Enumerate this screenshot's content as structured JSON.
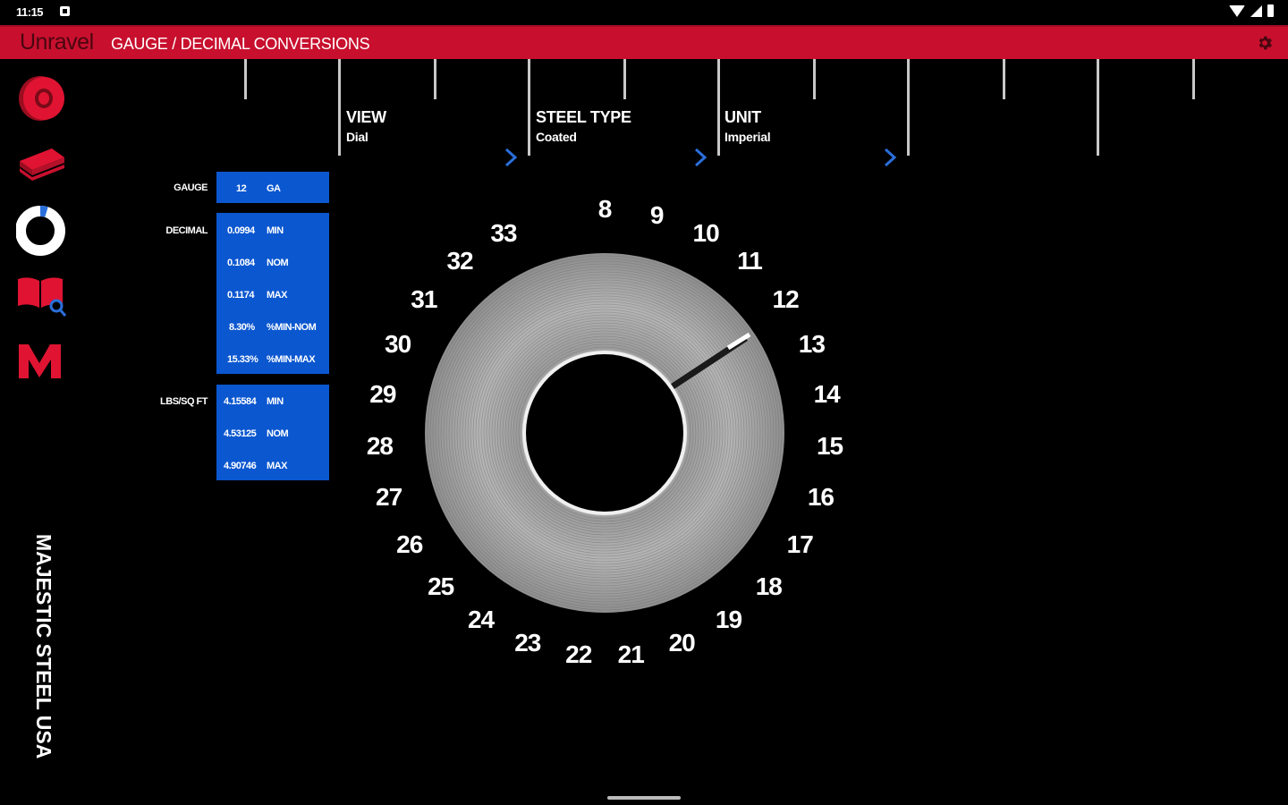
{
  "status_bar": {
    "time": "11:15"
  },
  "header": {
    "brand": "Unravel",
    "title": "GAUGE / DECIMAL CONVERSIONS"
  },
  "selectors": [
    {
      "label": "VIEW",
      "value": "Dial"
    },
    {
      "label": "STEEL TYPE",
      "value": "Coated"
    },
    {
      "label": "UNIT",
      "value": "Imperial"
    }
  ],
  "sidebar": {
    "items": [
      {
        "icon": "coil-icon"
      },
      {
        "icon": "sheets-icon"
      },
      {
        "icon": "ring-gauge-icon"
      },
      {
        "icon": "book-search-icon"
      },
      {
        "icon": "m-logo-icon"
      }
    ],
    "brand_vertical": "MAJESTIC STEEL USA"
  },
  "gauge": {
    "label": "GAUGE",
    "value": "12",
    "unit": "GA"
  },
  "decimal": {
    "label": "DECIMAL",
    "rows": [
      {
        "value": "0.0994",
        "unit": "MIN"
      },
      {
        "value": "0.1084",
        "unit": "NOM"
      },
      {
        "value": "0.1174",
        "unit": "MAX"
      },
      {
        "value": "8.30%",
        "unit": "%MIN-NOM"
      },
      {
        "value": "15.33%",
        "unit": "%MIN-MAX"
      }
    ]
  },
  "lbs": {
    "label": "LBS/SQ FT",
    "rows": [
      {
        "value": "4.15584",
        "unit": "MIN"
      },
      {
        "value": "4.53125",
        "unit": "NOM"
      },
      {
        "value": "4.90746",
        "unit": "MAX"
      }
    ]
  },
  "dial": {
    "selected": "12",
    "numbers": [
      "8",
      "9",
      "10",
      "11",
      "12",
      "13",
      "14",
      "15",
      "16",
      "17",
      "18",
      "19",
      "20",
      "21",
      "22",
      "23",
      "24",
      "25",
      "26",
      "27",
      "28",
      "29",
      "30",
      "31",
      "32",
      "33"
    ]
  },
  "colors": {
    "brand_red": "#c8102e",
    "panel_blue": "#0b57d0",
    "accent_blue": "#2a6fdb"
  }
}
